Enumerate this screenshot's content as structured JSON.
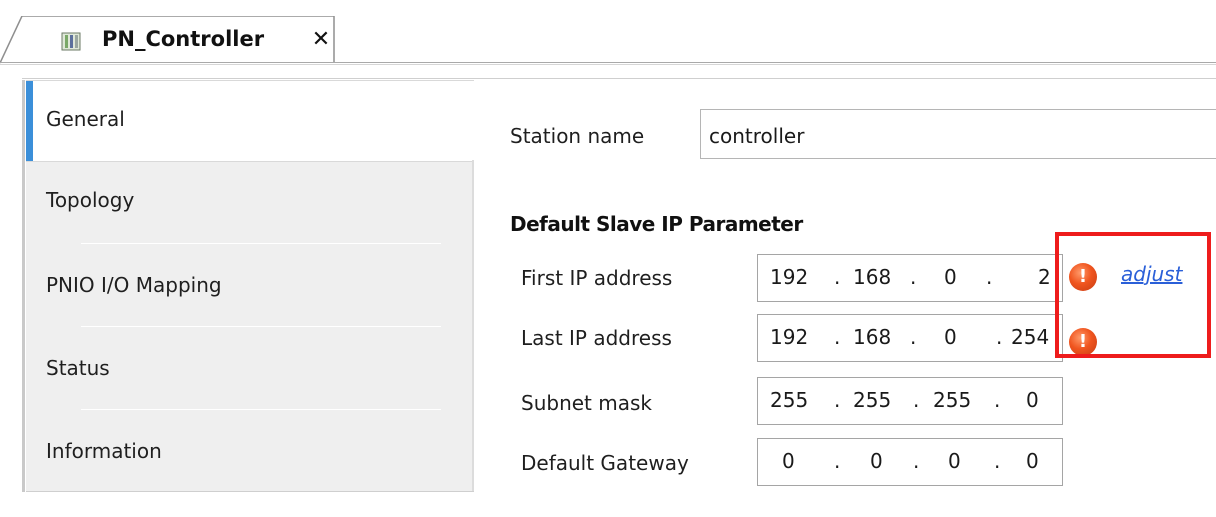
{
  "tab": {
    "title": "PN_Controller",
    "close_label": "✕",
    "icon": "device-icon"
  },
  "nav": {
    "items": [
      {
        "label": "General",
        "selected": true
      },
      {
        "label": "Topology"
      },
      {
        "label": "PNIO I/O Mapping"
      },
      {
        "label": "Status"
      },
      {
        "label": "Information"
      }
    ]
  },
  "form": {
    "station_name_label": "Station name",
    "station_name_value": "controller",
    "section_title": "Default Slave IP Parameter",
    "first_ip_label": "First IP address",
    "first_ip": [
      "192",
      ".",
      "168",
      ".",
      "0",
      ".",
      "2"
    ],
    "last_ip_label": "Last IP address",
    "last_ip": [
      "192",
      ".",
      "168",
      ".",
      "0",
      ".",
      "254"
    ],
    "subnet_label": "Subnet mask",
    "subnet": [
      "255",
      ".",
      "255",
      ".",
      "255",
      ".",
      "0"
    ],
    "gateway_label": "Default Gateway",
    "gateway": [
      "0",
      ".",
      "0",
      ".",
      "0",
      ".",
      "0"
    ],
    "error_glyph": "!",
    "adjust_label": "adjust"
  },
  "colors": {
    "accent": "#3b8fd9",
    "error": "#f0551f",
    "link": "#2a5fd8",
    "highlight": "#ee1c1c"
  }
}
